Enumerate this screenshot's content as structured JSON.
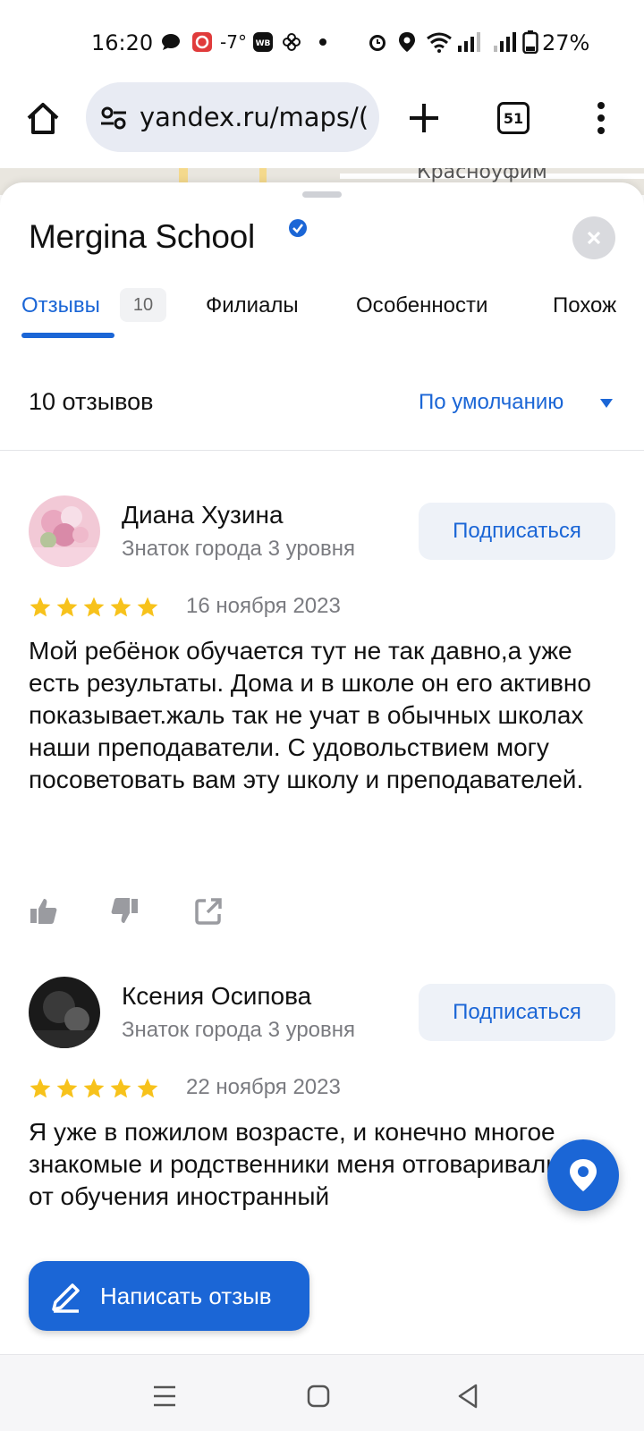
{
  "status_bar": {
    "time": "16:20",
    "temperature": "-7°",
    "battery_percent": "27%",
    "icons": [
      "chat-icon",
      "app-red-icon",
      "weather-icon",
      "wb-icon",
      "pinwheel-icon",
      "dot-icon",
      "alarm-icon",
      "location-icon",
      "wifi-icon",
      "signal-icon",
      "signal-icon",
      "battery-icon"
    ]
  },
  "browser": {
    "url": "yandex.ru/maps/(",
    "tab_count": "51"
  },
  "map": {
    "label": "Красноуфим"
  },
  "place": {
    "title": "Mergina School",
    "verified": true
  },
  "tabs": [
    {
      "label": "Отзывы",
      "count": "10",
      "active": true
    },
    {
      "label": "Филиалы"
    },
    {
      "label": "Особенности"
    },
    {
      "label": "Похож"
    }
  ],
  "reviews_summary": {
    "count_label": "10 отзывов",
    "sort_label": "По умолчанию"
  },
  "reviews": [
    {
      "author": "Диана Хузина",
      "level": "Знаток города 3 уровня",
      "subscribe_label": "Подписаться",
      "rating": 5,
      "date": "16 ноября 2023",
      "text": "Мой ребёнок обучается тут не так давно,а уже есть результаты. Дома и в школе он его активно показывает.жаль так не учат в обычных школах наши преподаватели. С удовольствием могу посоветовать вам эту школу и преподавателей."
    },
    {
      "author": "Ксения Осипова",
      "level": "Знаток города 3 уровня",
      "subscribe_label": "Подписаться",
      "rating": 5,
      "date": "22 ноября 2023",
      "text": "Я уже в пожилом возрасте, и конечно многое знакомые и родственники меня отговаривали от обучения иностранный"
    }
  ],
  "write_review_label": "Написать отзыв",
  "colors": {
    "accent": "#1b66d6",
    "star": "#f7c21b",
    "muted_text": "#7a7b80",
    "pill_bg": "#e8ebf3"
  }
}
